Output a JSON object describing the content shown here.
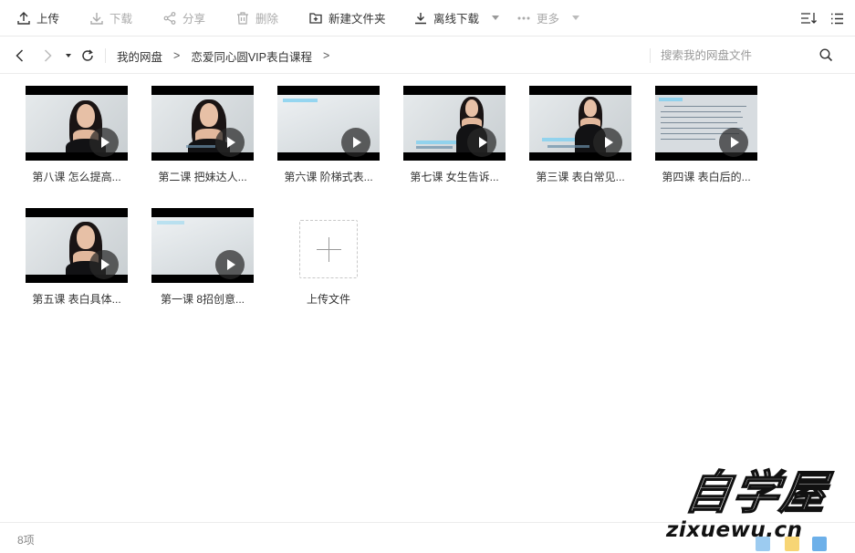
{
  "toolbar": {
    "upload": "上传",
    "download": "下载",
    "share": "分享",
    "delete": "删除",
    "new_folder": "新建文件夹",
    "offline_download": "离线下载",
    "more": "更多"
  },
  "breadcrumb": {
    "root": "我的网盘",
    "sep1": ">",
    "folder": "恋爱同心圆VIP表白课程",
    "sep2": ">"
  },
  "search": {
    "placeholder": "搜索我的网盘文件"
  },
  "files": [
    {
      "name": "第八课  怎么提高...",
      "icon": "video-file-icon"
    },
    {
      "name": "第二课 把妹达人...",
      "icon": "video-file-icon"
    },
    {
      "name": "第六课  阶梯式表...",
      "icon": "video-file-icon"
    },
    {
      "name": "第七课  女生告诉...",
      "icon": "video-file-icon"
    },
    {
      "name": "第三课 表白常见...",
      "icon": "video-file-icon"
    },
    {
      "name": "第四课 表白后的...",
      "icon": "video-file-icon"
    },
    {
      "name": "第五课 表白具体...",
      "icon": "video-file-icon"
    },
    {
      "name": "第一课 8招创意...",
      "icon": "video-file-icon"
    }
  ],
  "upload_tile": {
    "label": "上传文件"
  },
  "status": {
    "count": "8项"
  },
  "watermark": {
    "title": "自学屋",
    "url": "zixuewu.cn"
  },
  "colors": {
    "play_overlay": "#333333",
    "separator": "#ececec",
    "subtitle_accent": "#7fd0f0"
  }
}
